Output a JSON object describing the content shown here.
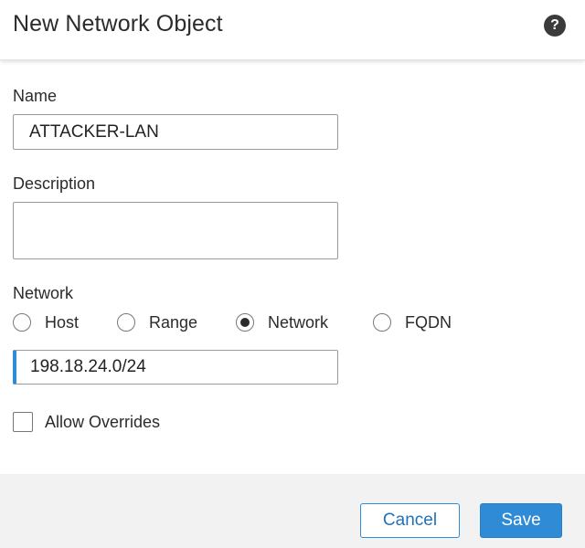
{
  "dialog": {
    "title": "New Network Object",
    "help_icon": "question-circle-icon"
  },
  "form": {
    "name": {
      "label": "Name",
      "value": "ATTACKER-LAN"
    },
    "description": {
      "label": "Description",
      "value": ""
    },
    "network": {
      "label": "Network",
      "options": [
        {
          "label": "Host",
          "selected": false
        },
        {
          "label": "Range",
          "selected": false
        },
        {
          "label": "Network",
          "selected": true
        },
        {
          "label": "FQDN",
          "selected": false
        }
      ],
      "value": "198.18.24.0/24"
    },
    "allow_overrides": {
      "label": "Allow Overrides",
      "checked": false
    }
  },
  "footer": {
    "cancel_label": "Cancel",
    "save_label": "Save"
  },
  "colors": {
    "accent": "#2f8bd6",
    "footer_bg": "#f2f2f2",
    "text": "#2b2b2b"
  }
}
